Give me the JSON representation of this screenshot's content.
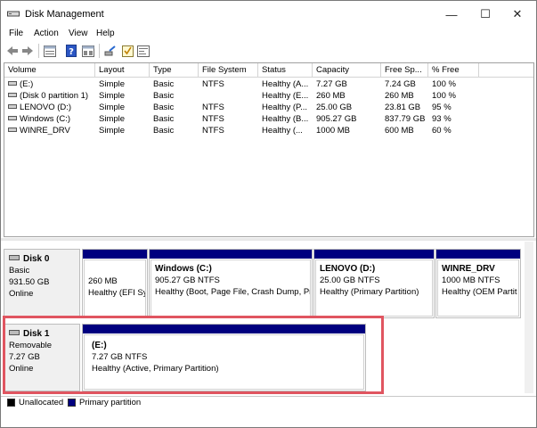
{
  "window": {
    "title": "Disk Management"
  },
  "controls": {
    "minimize": "—",
    "maximize": "☐",
    "close": "✕"
  },
  "menu": [
    "File",
    "Action",
    "View",
    "Help"
  ],
  "toolbar_icons": [
    "back-arrow-icon",
    "forward-arrow-icon",
    "properties-list-icon",
    "help-icon",
    "disk-list-icon",
    "connect-icon",
    "checklist-icon",
    "settings-icon"
  ],
  "volume_list": {
    "columns": [
      "Volume",
      "Layout",
      "Type",
      "File System",
      "Status",
      "Capacity",
      "Free Sp...",
      "% Free"
    ],
    "rows": [
      [
        "(E:)",
        "Simple",
        "Basic",
        "NTFS",
        "Healthy (A...",
        "7.27 GB",
        "7.24 GB",
        "100 %"
      ],
      [
        "(Disk 0 partition 1)",
        "Simple",
        "Basic",
        "",
        "Healthy (E...",
        "260 MB",
        "260 MB",
        "100 %"
      ],
      [
        "LENOVO (D:)",
        "Simple",
        "Basic",
        "NTFS",
        "Healthy (P...",
        "25.00 GB",
        "23.81 GB",
        "95 %"
      ],
      [
        "Windows (C:)",
        "Simple",
        "Basic",
        "NTFS",
        "Healthy (B...",
        "905.27 GB",
        "837.79 GB",
        "93 %"
      ],
      [
        "WINRE_DRV",
        "Simple",
        "Basic",
        "NTFS",
        "Healthy (...",
        "1000 MB",
        "600 MB",
        "60 %"
      ]
    ]
  },
  "disks": [
    {
      "name": "Disk 0",
      "type": "Basic",
      "size": "931.50 GB",
      "status": "Online",
      "partitions": [
        {
          "title": "",
          "size": "260 MB",
          "status": "Healthy (EFI Sy"
        },
        {
          "title": "Windows  (C:)",
          "size": "905.27 GB NTFS",
          "status": "Healthy (Boot, Page File, Crash Dump, Pri"
        },
        {
          "title": "LENOVO  (D:)",
          "size": "25.00 GB NTFS",
          "status": "Healthy (Primary Partition)"
        },
        {
          "title": "WINRE_DRV",
          "size": "1000 MB NTFS",
          "status": "Healthy (OEM Partit"
        }
      ]
    },
    {
      "name": "Disk 1",
      "type": "Removable",
      "size": "7.27 GB",
      "status": "Online",
      "partitions": [
        {
          "title": "(E:)",
          "size": "7.27 GB NTFS",
          "status": "Healthy (Active, Primary Partition)"
        }
      ]
    }
  ],
  "legend": [
    {
      "label": "Unallocated",
      "color": "#000000"
    },
    {
      "label": "Primary partition",
      "color": "#00007f"
    }
  ],
  "colors": {
    "partition_bar": "#00007f",
    "highlight": "#e05560"
  }
}
